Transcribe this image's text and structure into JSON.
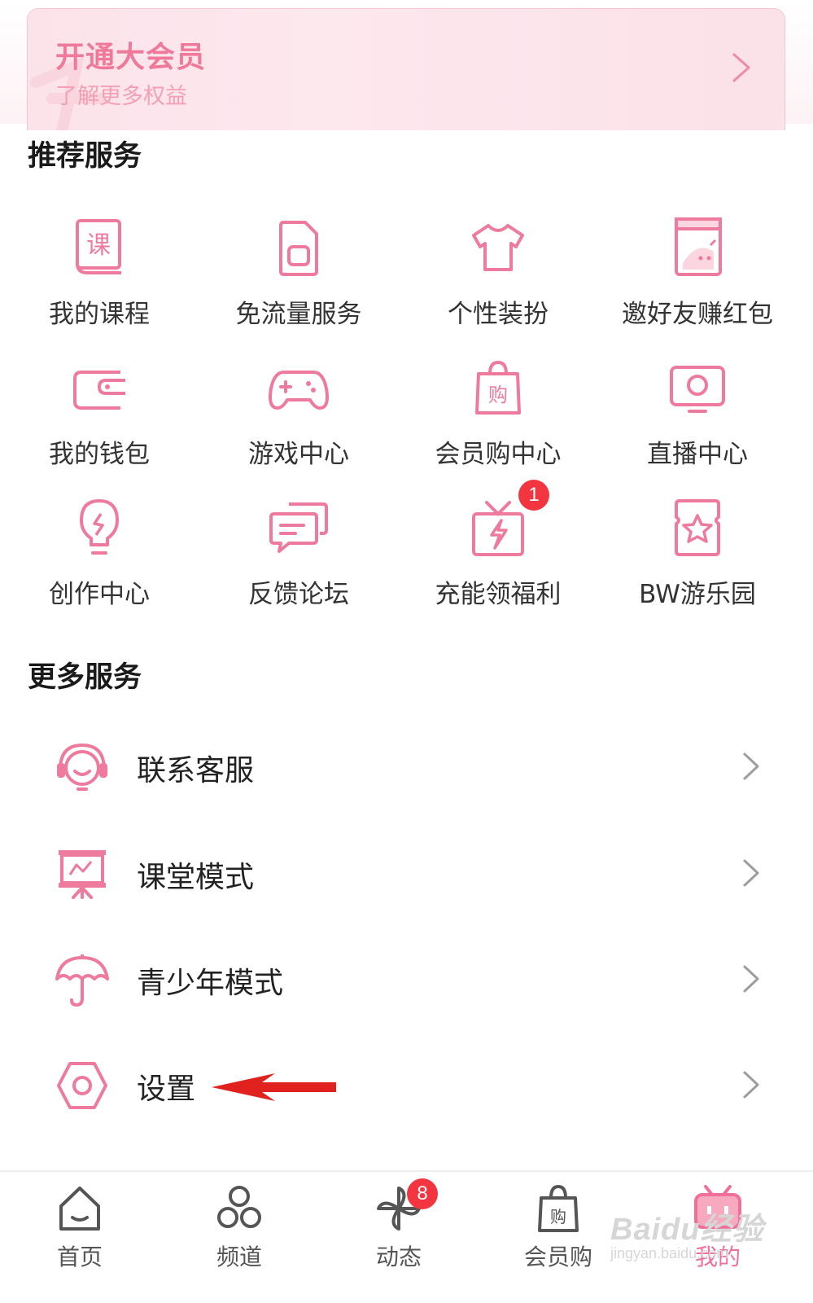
{
  "vip": {
    "title": "开通大会员",
    "subtitle": "了解更多权益",
    "arrow_icon": "chevron-right-icon"
  },
  "recommended": {
    "title": "推荐服务",
    "items": [
      {
        "label": "我的课程",
        "icon": "course-book-icon"
      },
      {
        "label": "免流量服务",
        "icon": "sim-card-icon"
      },
      {
        "label": "个性装扮",
        "icon": "tshirt-icon"
      },
      {
        "label": "邀好友赚红包",
        "icon": "red-envelope-icon"
      },
      {
        "label": "我的钱包",
        "icon": "wallet-icon"
      },
      {
        "label": "游戏中心",
        "icon": "gamepad-icon"
      },
      {
        "label": "会员购中心",
        "icon": "shopping-bag-icon"
      },
      {
        "label": "直播中心",
        "icon": "live-tv-icon"
      },
      {
        "label": "创作中心",
        "icon": "lightbulb-icon"
      },
      {
        "label": "反馈论坛",
        "icon": "chat-bubbles-icon"
      },
      {
        "label": "充能领福利",
        "icon": "gift-bolt-icon",
        "badge": "1"
      },
      {
        "label": "BW游乐园",
        "icon": "star-ticket-icon"
      }
    ]
  },
  "more": {
    "title": "更多服务",
    "items": [
      {
        "label": "联系客服",
        "icon": "headset-icon"
      },
      {
        "label": "课堂模式",
        "icon": "presentation-board-icon"
      },
      {
        "label": "青少年模式",
        "icon": "umbrella-icon"
      },
      {
        "label": "设置",
        "icon": "hexagon-gear-icon"
      }
    ]
  },
  "bottom_nav": {
    "items": [
      {
        "label": "首页",
        "icon": "home-icon"
      },
      {
        "label": "频道",
        "icon": "channels-icon"
      },
      {
        "label": "动态",
        "icon": "pinwheel-icon",
        "badge": "8"
      },
      {
        "label": "会员购",
        "icon": "shopping-bag-icon"
      },
      {
        "label": "我的",
        "icon": "tv-mascot-icon",
        "active": true
      }
    ]
  },
  "watermark": {
    "line1": "Baidu经验",
    "line2": "jingyan.baidu.com"
  },
  "colors": {
    "accent": "#f0709a",
    "icon_pink": "#ee7a9d",
    "badge_red": "#f2353f",
    "arrow_red": "#e0211d"
  }
}
